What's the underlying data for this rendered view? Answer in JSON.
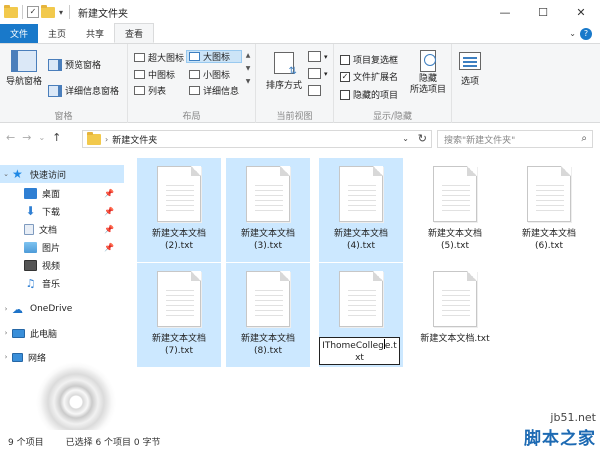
{
  "window": {
    "title": "新建文件夹",
    "min": "—",
    "max": "☐",
    "close": "✕"
  },
  "ribbon_tabs": {
    "file": "文件",
    "home": "主页",
    "share": "共享",
    "view": "查看"
  },
  "ribbon": {
    "panes": {
      "nav_pane": "导航窗格",
      "preview": "预览窗格",
      "details": "详细信息窗格",
      "label": "窗格"
    },
    "layout": {
      "xlarge": "超大图标",
      "large": "大图标",
      "medium": "中图标",
      "small": "小图标",
      "list": "列表",
      "details": "详细信息",
      "label": "布局"
    },
    "current_view": {
      "sort": "排序方式",
      "label": "当前视图"
    },
    "show_hide": {
      "item_checkbox": "项目复选框",
      "extensions": "文件扩展名",
      "hidden_items": "隐藏的项目",
      "hide_selected": "隐藏\n所选项目",
      "hide_selected_1": "隐藏",
      "hide_selected_2": "所选项目",
      "label": "显示/隐藏"
    },
    "options": "选项"
  },
  "address": {
    "path": "新建文件夹",
    "search_placeholder": "搜索\"新建文件夹\""
  },
  "navpane": {
    "quick_access": "快速访问",
    "desktop": "桌面",
    "downloads": "下载",
    "documents": "文档",
    "pictures": "图片",
    "videos": "视频",
    "music": "音乐",
    "onedrive": "OneDrive",
    "this_pc": "此电脑",
    "network": "网络"
  },
  "files": [
    {
      "line1": "新建文本文档",
      "line2": "(2).txt",
      "selected": true
    },
    {
      "line1": "新建文本文档",
      "line2": "(3).txt",
      "selected": true
    },
    {
      "line1": "新建文本文档",
      "line2": "(4).txt",
      "selected": true
    },
    {
      "line1": "新建文本文档",
      "line2": "(5).txt",
      "selected": false
    },
    {
      "line1": "新建文本文档",
      "line2": "(6).txt",
      "selected": false
    },
    {
      "line1": "新建文本文档",
      "line2": "(7).txt",
      "selected": true
    },
    {
      "line1": "新建文本文档",
      "line2": "(8).txt",
      "selected": true
    },
    {
      "line1": "",
      "line2": "",
      "selected": true
    },
    {
      "line1": "新建文本文档.txt",
      "line2": "",
      "selected": false
    }
  ],
  "rename": {
    "before_caret": "IThomeColleg",
    "after_caret": "e.t",
    "line2": "xt"
  },
  "status": {
    "count": "9 个项目",
    "selected": "已选择 6 个项目 0 字节"
  },
  "watermark": {
    "site": "jb51.net",
    "brand": "脚本之家"
  }
}
